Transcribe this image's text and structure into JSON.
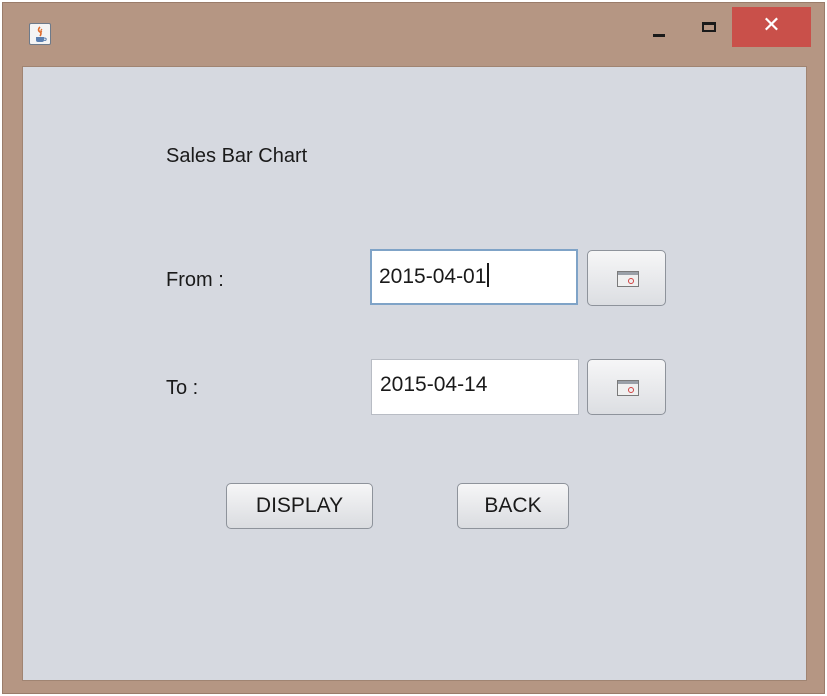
{
  "window": {
    "app_icon": "java-coffee-icon",
    "minimize_icon": "minimize-icon",
    "maximize_icon": "maximize-icon",
    "close_symbol": "✕",
    "close_color": "#c9504a"
  },
  "form": {
    "title": "Sales Bar Chart",
    "from_label": "From :",
    "from_value": "2015-04-01",
    "to_label": "To :",
    "to_value": "2015-04-14",
    "calendar_icon": "calendar-icon",
    "display_label": "DISPLAY",
    "back_label": "BACK"
  }
}
